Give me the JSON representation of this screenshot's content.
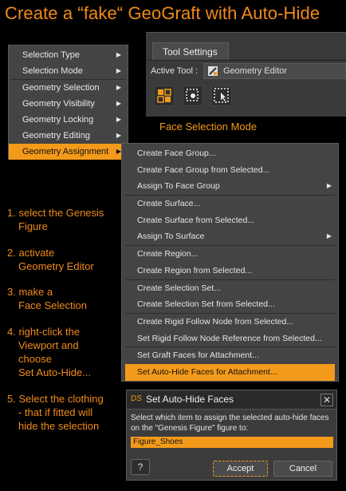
{
  "title": "Create a “fake“ GeoGraft with Auto-Hide",
  "menu1": {
    "items": [
      {
        "label": "Selection Type"
      },
      {
        "label": "Selection Mode"
      },
      {
        "label": "Geometry Selection"
      },
      {
        "label": "Geometry Visibility"
      },
      {
        "label": "Geometry Locking"
      },
      {
        "label": "Geometry Editing"
      },
      {
        "label": "Geometry Assignment"
      }
    ],
    "highlighted": "Geometry Assignment"
  },
  "tool_settings": {
    "tab": "Tool Settings",
    "active_tool_label": "Active Tool :",
    "active_tool_value": "Geometry Editor",
    "mode_caption": "Face Selection Mode"
  },
  "menu2": {
    "items": [
      "Create Face Group...",
      "Create Face Group from Selected...",
      "Assign To Face Group",
      "Create Surface...",
      "Create Surface from Selected...",
      "Assign To Surface",
      "Create Region...",
      "Create Region from Selected...",
      "Create Selection Set...",
      "Create Selection Set from Selected...",
      "Create Rigid Follow Node from Selected...",
      "Set Rigid Follow Node Reference from Selected...",
      "Set Graft Faces for Attachment...",
      "Set Auto-Hide Faces for Attachment..."
    ],
    "highlighted": "Set Auto-Hide Faces for Attachment..."
  },
  "steps": [
    {
      "num": "1.",
      "lines": [
        "select the Genesis",
        "Figure"
      ]
    },
    {
      "num": "2.",
      "lines": [
        "activate",
        "Geometry Editor"
      ]
    },
    {
      "num": "3.",
      "lines": [
        "make a",
        "Face Selection"
      ]
    },
    {
      "num": "4.",
      "lines": [
        "right-click the",
        "Viewport and",
        "choose",
        "Set Auto-Hide..."
      ]
    },
    {
      "num": "5.",
      "lines": [
        "Select the clothing",
        "- that if fitted will",
        "hide the selection"
      ]
    }
  ],
  "dialog": {
    "logo": "DS",
    "title": "Set Auto-Hide Faces",
    "close": "✕",
    "message": "Select which item to assign the selected auto-hide faces on the \"Genesis Figure\" figure to:",
    "selected_item": "Figure_Shoes",
    "help": "?",
    "accept": "Accept",
    "cancel": "Cancel"
  },
  "colors": {
    "accent": "#f49a1a",
    "menu_bg": "#444444",
    "background": "#000000"
  }
}
